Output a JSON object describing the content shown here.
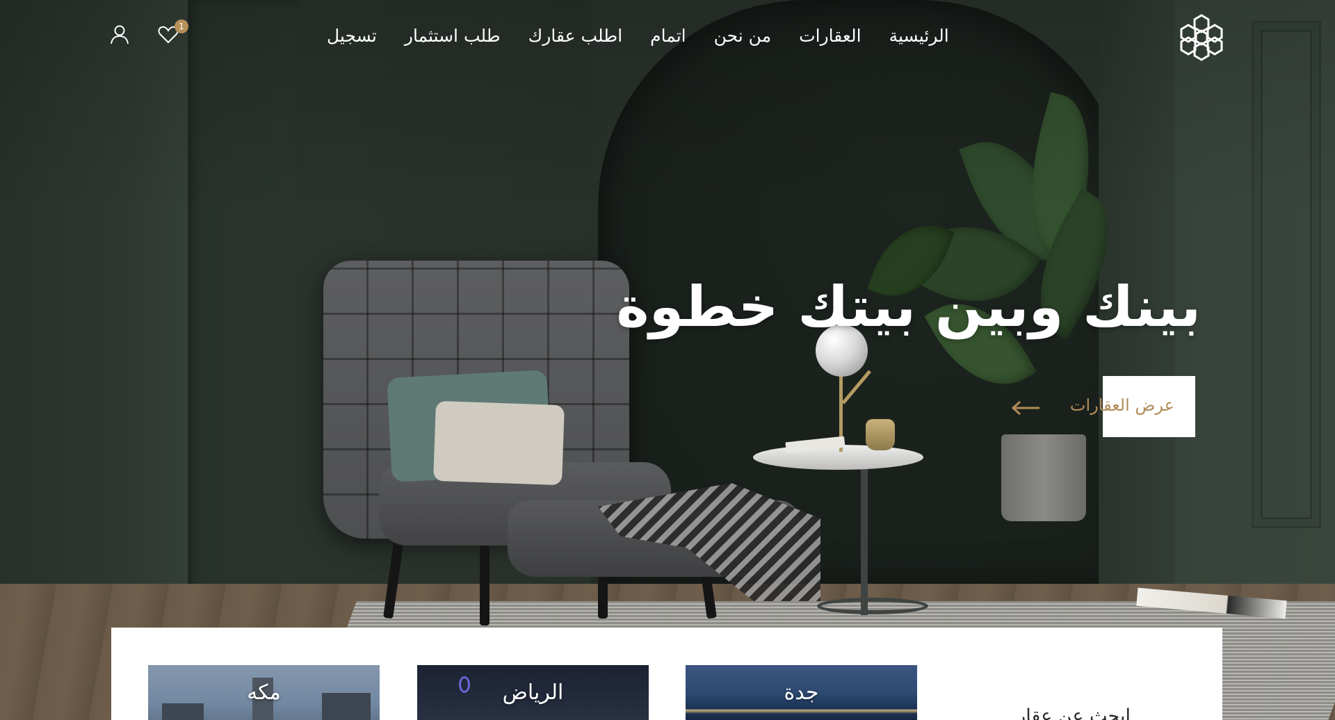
{
  "header": {
    "nav": [
      {
        "label": "الرئيسية"
      },
      {
        "label": "العقارات"
      },
      {
        "label": "من نحن"
      },
      {
        "label": "اتمام"
      },
      {
        "label": "اطلب عقارك"
      },
      {
        "label": "طلب استثمار"
      },
      {
        "label": "تسجيل"
      }
    ],
    "favorites_count": "1",
    "icons": {
      "logo": "hexagon-flower-logo",
      "favorites": "heart-icon",
      "account": "user-icon"
    }
  },
  "hero": {
    "title": "بينك وبين بيتك خطوة",
    "cta_label": "عرض العقارات"
  },
  "city_search": {
    "title": "ابحث عن عقار",
    "cities": [
      {
        "name": "جدة"
      },
      {
        "name": "الرياض"
      },
      {
        "name": "مكه"
      }
    ]
  },
  "colors": {
    "accent_gold": "#b7915a",
    "wall_green": "#2b332d",
    "white": "#ffffff"
  }
}
